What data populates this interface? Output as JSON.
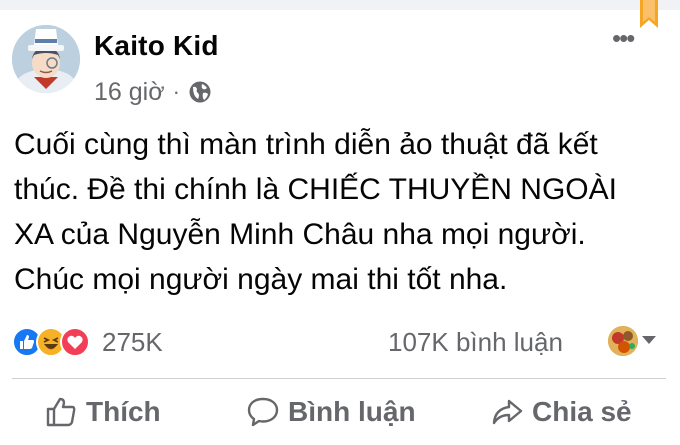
{
  "post": {
    "author": "Kaito Kid",
    "time": "16 giờ",
    "separator": "·",
    "audience_icon": "globe-icon",
    "text_lines": [
      "Cuối cùng thì màn trình diễn ảo thuật đã kết",
      "thúc. Đề thi chính là CHIẾC THUYỀN NGOÀI",
      "XA của Nguyễn Minh Châu nha mọi người.",
      "Chúc mọi người ngày mai thi tốt nha."
    ]
  },
  "stats": {
    "reactions": [
      "like-reaction-icon",
      "haha-reaction-icon",
      "love-reaction-icon"
    ],
    "reaction_count": "275K",
    "comment_count": "107K bình luận"
  },
  "actions": {
    "like_label": "Thích",
    "comment_label": "Bình luận",
    "share_label": "Chia sẻ"
  },
  "colors": {
    "text": "#050505",
    "secondary": "#65676b",
    "like_blue": "#1877f2",
    "love_red": "#f33e58",
    "haha_yellow": "#f7b125",
    "bookmark_orange": "#f5a623"
  }
}
